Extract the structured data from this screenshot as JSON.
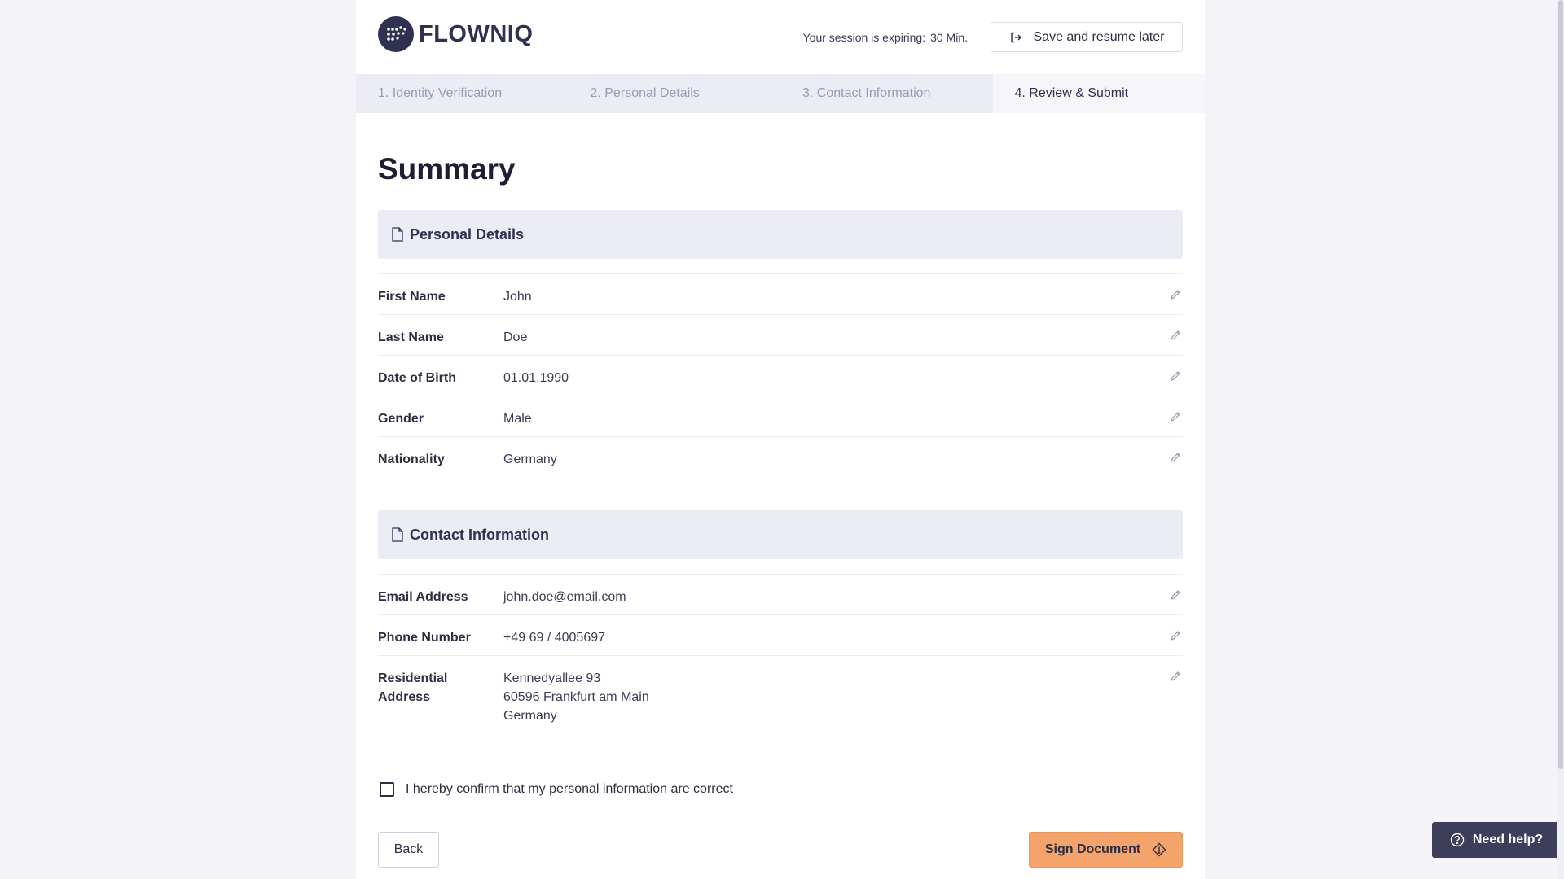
{
  "brand": {
    "name": "FLOWNIQ",
    "color": "#2f3150"
  },
  "header": {
    "session_label": "Your session is expiring:",
    "session_value": "30 Min.",
    "save_label": "Save and resume later",
    "save_icon": "sign-out-icon"
  },
  "steps": [
    {
      "label": "1. Identity Verification",
      "active": false
    },
    {
      "label": "2. Personal Details",
      "active": false
    },
    {
      "label": "3. Contact Information",
      "active": false
    },
    {
      "label": "4. Review & Submit",
      "active": true
    }
  ],
  "page_title": "Summary",
  "personal": {
    "heading": "Personal Details",
    "icon": "document-icon",
    "rows": [
      {
        "label": "First Name",
        "value": "John"
      },
      {
        "label": "Last Name",
        "value": "Doe"
      },
      {
        "label": "Date of Birth",
        "value": "01.01.1990"
      },
      {
        "label": "Gender",
        "value": "Male"
      },
      {
        "label": "Nationality",
        "value": "Germany"
      }
    ]
  },
  "contact": {
    "heading": "Contact Information",
    "icon": "document-icon",
    "rows": [
      {
        "label": "Email Address",
        "value": "john.doe@email.com"
      },
      {
        "label": "Phone Number",
        "value": "+49 69 / 4005697"
      },
      {
        "label": "Residential Address",
        "value": "Kennedyallee 93\n60596 Frankfurt am Main\nGermany"
      }
    ]
  },
  "confirm": {
    "label": "I hereby confirm that my personal information are correct",
    "checked": false
  },
  "actions": {
    "back_label": "Back",
    "sign_label": "Sign Document",
    "sign_color": "#f4a46a"
  },
  "help": {
    "label": "Need help?",
    "icon": "question-circle-icon",
    "color": "#3c3e5a"
  }
}
